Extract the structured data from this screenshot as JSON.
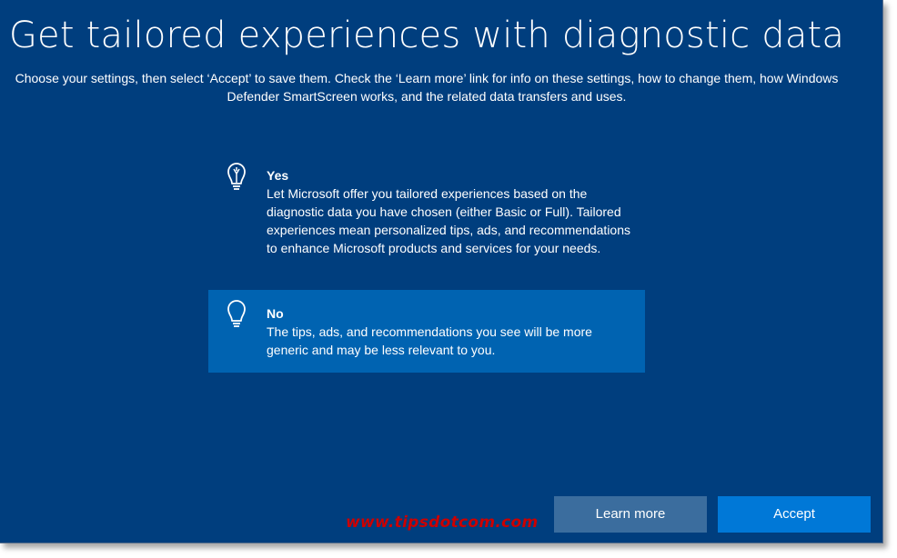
{
  "title": "Get tailored experiences with diagnostic data",
  "subtitle": "Choose your settings, then select ‘Accept’ to save them. Check the ‘Learn more’ link for info on these settings, how to change them, how Windows Defender SmartScreen works, and the related data transfers and uses.",
  "options": [
    {
      "heading": "Yes",
      "description": "Let Microsoft offer you tailored experiences based on the diagnostic data you have chosen (either Basic or Full). Tailored experiences mean personalized tips, ads, and recommendations to enhance Microsoft products and services for your needs.",
      "icon": "lightbulb-on-icon",
      "selected": false
    },
    {
      "heading": "No",
      "description": "The tips, ads, and recommendations you see will be more generic and may be less relevant to you.",
      "icon": "lightbulb-off-icon",
      "selected": true
    }
  ],
  "buttons": {
    "learn_more": "Learn more",
    "accept": "Accept"
  },
  "watermark": "www.tipsdotcom.com",
  "colors": {
    "background": "#003e7e",
    "selected_option": "#0063b1",
    "learn_more_button": "#3b6d9e",
    "accept_button": "#0078d7",
    "watermark": "#cc0000"
  }
}
